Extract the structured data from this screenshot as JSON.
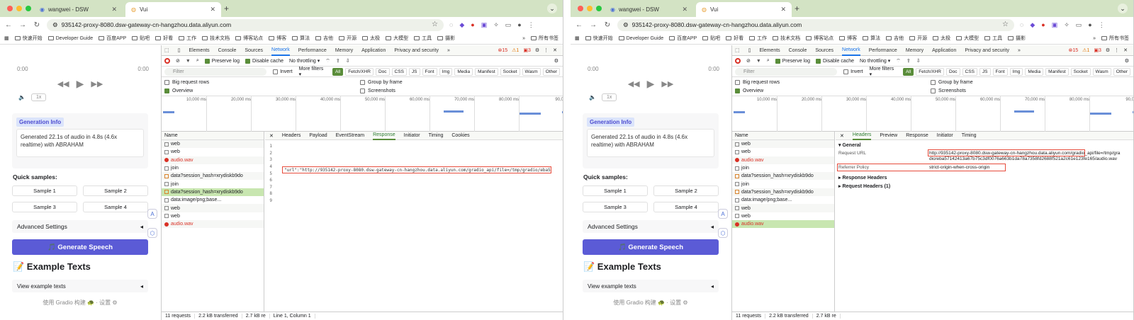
{
  "browser": {
    "tabs": [
      {
        "label": "wangwei - DSW"
      },
      {
        "label": "Vui"
      }
    ],
    "url": "935142-proxy-8080.dsw-gateway-cn-hangzhou.data.aliyun.com",
    "bookmarks": [
      "快速开始",
      "Developer Guide",
      "百度APP",
      "贴吧",
      "好看",
      "工作",
      "技术文档",
      "博客站点",
      "博客",
      "算法",
      "吉他",
      "开源",
      "太极",
      "大模型",
      "工具",
      "摄影"
    ],
    "all_bookmarks": "所有书签"
  },
  "app": {
    "time_start": "0:00",
    "time_end": "0:00",
    "speed": "1x",
    "gen_info_title": "Generation Info",
    "gen_info_text": "Generated 22.1s of audio in 4.8s (4.6x realtime) with ABRAHAM",
    "quick_samples": "Quick samples:",
    "samples": [
      "Sample 1",
      "Sample 2",
      "Sample 3",
      "Sample 4"
    ],
    "advanced": "Advanced Settings",
    "generate": "🎵 Generate Speech",
    "example_texts": "📝 Example Texts",
    "view_examples": "View example texts",
    "footer": "使用 Gradio 构建 🐢  ·  设置 ⚙"
  },
  "devtools": {
    "panels": [
      "Elements",
      "Console",
      "Sources",
      "Network",
      "Performance",
      "Memory",
      "Application",
      "Privacy and security"
    ],
    "active_panel": "Network",
    "errors": "15",
    "warnings": "1",
    "issues": "3",
    "preserve_log": "Preserve log",
    "disable_cache": "Disable cache",
    "throttling": "No throttling",
    "filter_placeholder": "Filter",
    "invert": "Invert",
    "more_filters": "More filters ▾",
    "types": [
      "All",
      "Fetch/XHR",
      "Doc",
      "CSS",
      "JS",
      "Font",
      "Img",
      "Media",
      "Manifest",
      "Socket",
      "Wasm",
      "Other"
    ],
    "big_rows": "Big request rows",
    "overview": "Overview",
    "group_by_frame": "Group by frame",
    "screenshots": "Screenshots",
    "ticks": [
      "10,000 ms",
      "20,000 ms",
      "30,000 ms",
      "40,000 ms",
      "50,000 ms",
      "60,000 ms",
      "70,000 ms",
      "80,000 ms",
      "90,0"
    ],
    "name_header": "Name",
    "requests": [
      {
        "name": "web",
        "kind": "doc"
      },
      {
        "name": "web",
        "kind": "doc"
      },
      {
        "name": "audio.wav",
        "kind": "error"
      },
      {
        "name": "join",
        "kind": "doc"
      },
      {
        "name": "data?session_hash=xrydiskb9do",
        "kind": "xhr"
      },
      {
        "name": "join",
        "kind": "doc"
      },
      {
        "name": "data?session_hash=xrydiskb9do",
        "kind": "xhr"
      },
      {
        "name": "data:image/png;base...",
        "kind": "img"
      },
      {
        "name": "web",
        "kind": "doc"
      },
      {
        "name": "web",
        "kind": "doc"
      },
      {
        "name": "audio.wav",
        "kind": "error"
      }
    ],
    "status": {
      "requests": "11 requests",
      "transferred": "2.2 kB transferred",
      "resources": "2.7 kB re",
      "cursor": "Line 1, Column 1"
    }
  },
  "left_detail": {
    "tabs": [
      "Headers",
      "Payload",
      "EventStream",
      "Response",
      "Initiator",
      "Timing",
      "Cookies"
    ],
    "active": "Response",
    "lines": [
      "1",
      "2",
      "3",
      "4",
      "5",
      "6",
      "7",
      "8",
      "9"
    ],
    "url_line": "\"url\":\"http://935142-proxy-8080.dsw-gateway-cn-hangzhou.data.aliyun.com/gradio_api/file=/tmp/gradio/eba57"
  },
  "right_detail": {
    "tabs": [
      "Headers",
      "Preview",
      "Response",
      "Initiator",
      "Timing"
    ],
    "active": "Headers",
    "general": "▾ General",
    "req_url_k": "Request URL",
    "req_url_v": "http://935142-proxy-8080.dsw-gateway-cn-hangzhou.data.aliyun.com/gradio_api/file=/tmp/gradio/eba57142413a67b75c3df0076a663b1da78a7358fd2688f521a2c61e123fe165/audio.wav",
    "ref_k": "Referrer Policy",
    "ref_v": "strict-origin-when-cross-origin",
    "resp_headers": "▸ Response Headers",
    "req_headers": "▸ Request Headers (1)"
  },
  "colors": {
    "accent": "#5b5bd6",
    "devtools_green": "#5a8d3a",
    "error": "#d93025",
    "tabbar": "#d3e3c4"
  }
}
